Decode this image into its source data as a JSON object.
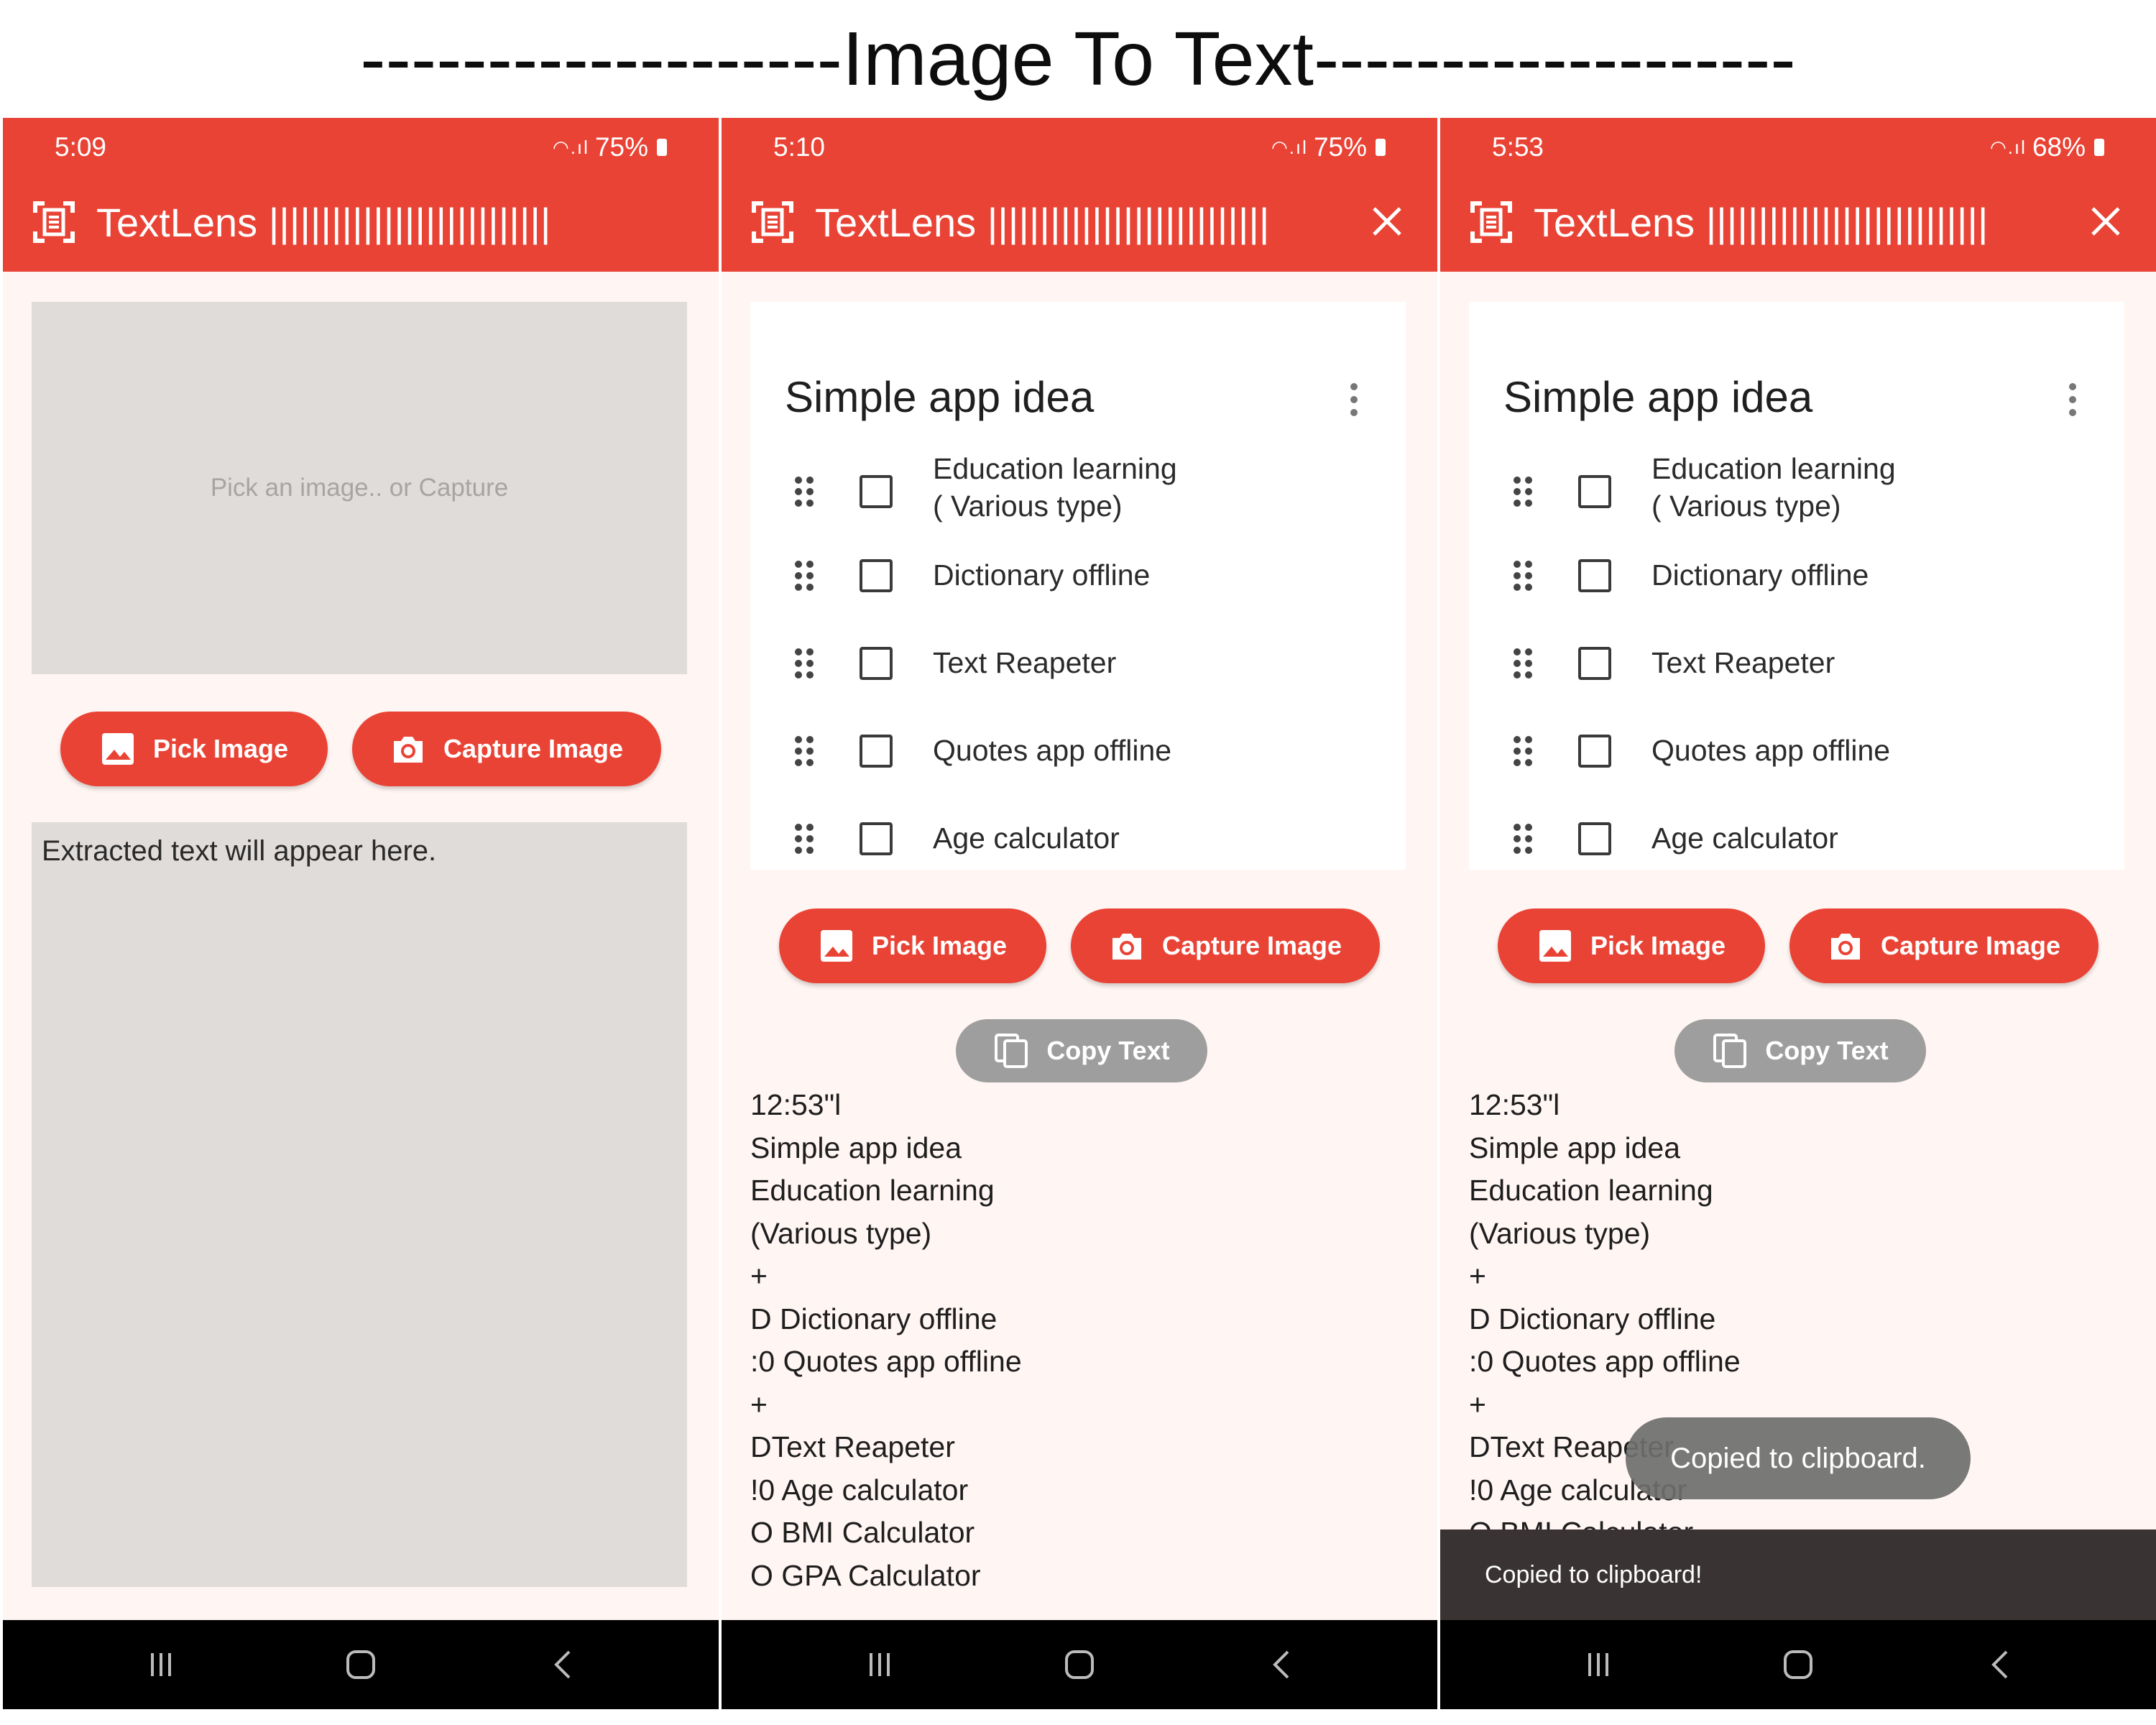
{
  "header": {
    "title": "-------------------Image To Text-------------------"
  },
  "phones": [
    {
      "status": {
        "time": "5:09",
        "battery": "75%"
      },
      "appbar": {
        "title": "TextLens |||||||||||||||||||||||||||"
      },
      "image_area": {
        "placeholder": "Pick an image.. or Capture"
      },
      "buttons": {
        "pick": "Pick Image",
        "capture": "Capture Image"
      },
      "extracted": {
        "text": "Extracted text will appear here."
      }
    },
    {
      "status": {
        "time": "5:10",
        "battery": "75%"
      },
      "appbar": {
        "title": "TextLens |||||||||||||||||||||||||||"
      },
      "note": {
        "title": "Simple app idea",
        "items": [
          {
            "line1": "Education learning",
            "line2": "( Various type)"
          },
          {
            "line1": "Dictionary offline"
          },
          {
            "line1": "Text Reapeter"
          },
          {
            "line1": "Quotes app offline"
          },
          {
            "line1": "Age calculator"
          }
        ]
      },
      "buttons": {
        "pick": "Pick Image",
        "capture": "Capture Image",
        "copy": "Copy Text"
      },
      "result": "12:53\"l\nSimple app idea\nEducation learning\n(Various type)\n+\nD Dictionary offline\n:0 Quotes app offline\n+\nDText Reapeter\n!0 Age calculator\nO BMI Calculator\nO GPA Calculator"
    },
    {
      "status": {
        "time": "5:53",
        "battery": "68%"
      },
      "appbar": {
        "title": "TextLens |||||||||||||||||||||||||||"
      },
      "note": {
        "title": "Simple app idea",
        "items": [
          {
            "line1": "Education learning",
            "line2": "( Various type)"
          },
          {
            "line1": "Dictionary offline"
          },
          {
            "line1": "Text Reapeter"
          },
          {
            "line1": "Quotes app offline"
          },
          {
            "line1": "Age calculator"
          }
        ]
      },
      "buttons": {
        "pick": "Pick Image",
        "capture": "Capture Image",
        "copy": "Copy Text"
      },
      "result": "12:53\"l\nSimple app idea\nEducation learning\n(Various type)\n+\nD Dictionary offline\n:0 Quotes app offline\n+\nDText Reapeter\n!0 Age calculator\nO BMI Calculator",
      "toast": "Copied to clipboard.",
      "snackbar": "Copied to clipboard!"
    }
  ],
  "colors": {
    "accent": "#e94335",
    "background": "#fff5f3",
    "placeholder_box": "#e0dcd9",
    "copy_button": "#9e9e9e",
    "snackbar": "#3a3333"
  },
  "icons": [
    "document-scanner-icon",
    "close-icon",
    "image-icon",
    "camera-icon",
    "copy-icon",
    "drag-handle-icon",
    "checkbox-icon",
    "more-vert-icon",
    "nav-recent-icon",
    "nav-home-icon",
    "nav-back-icon"
  ]
}
